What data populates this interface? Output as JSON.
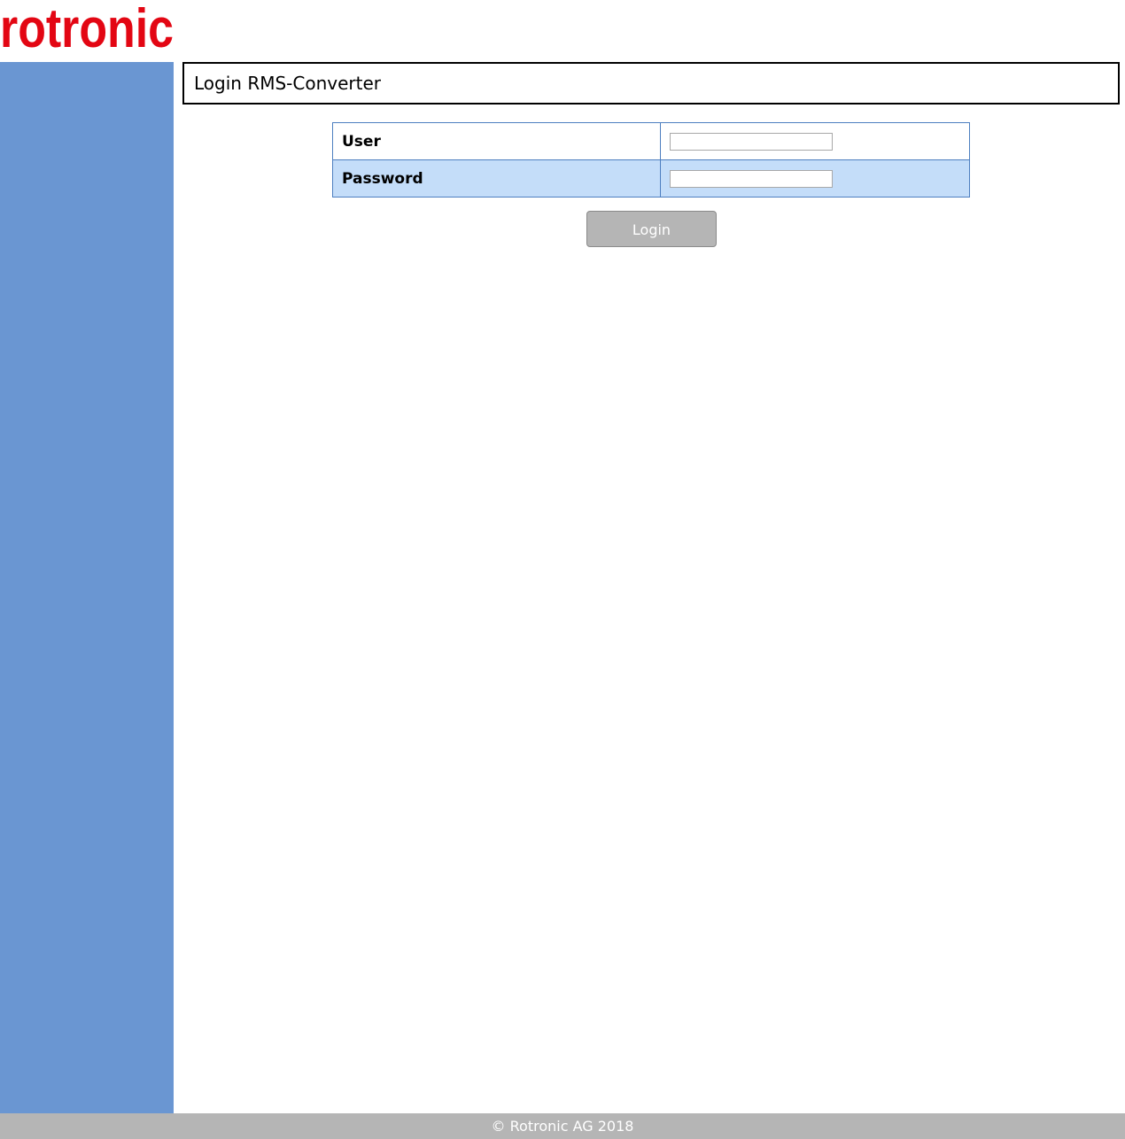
{
  "brand": {
    "logo_text": "rotronic",
    "logo_color": "#e30613"
  },
  "sidebar": {
    "color": "#6a96d2"
  },
  "header": {
    "title": "Login RMS-Converter"
  },
  "form": {
    "user_label": "User",
    "user_value": "",
    "password_label": "Password",
    "password_value": "",
    "login_button": "Login"
  },
  "footer": {
    "text": "© Rotronic AG 2018"
  }
}
